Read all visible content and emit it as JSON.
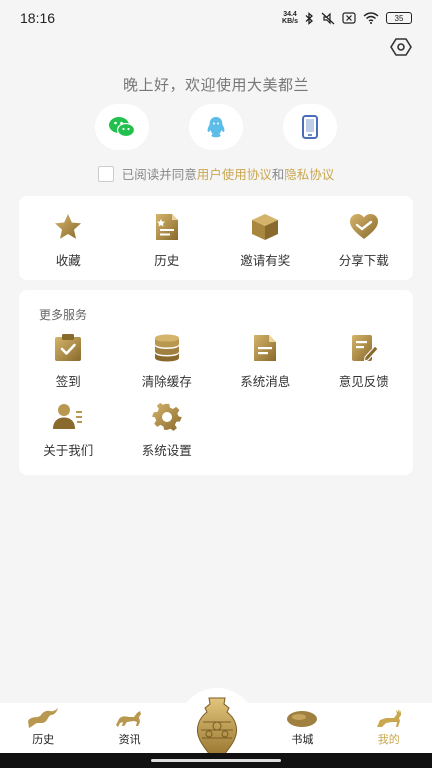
{
  "status": {
    "time": "18:16",
    "net_speed_value": "34.4",
    "net_speed_unit": "KB/s",
    "battery": "35"
  },
  "greeting": "晚上好，欢迎使用大美都兰",
  "login": [
    {
      "name": "wechat-login-button",
      "icon": "wechat-icon"
    },
    {
      "name": "qq-login-button",
      "icon": "qq-icon"
    },
    {
      "name": "phone-login-button",
      "icon": "phone-icon"
    }
  ],
  "agreement": {
    "prefix": "已阅读并同意",
    "user_agreement": "用户使用协议",
    "and": "和",
    "privacy": "隐私协议"
  },
  "quick_actions": [
    {
      "label": "收藏",
      "icon": "star-icon"
    },
    {
      "label": "历史",
      "icon": "document-icon"
    },
    {
      "label": "邀请有奖",
      "icon": "box-icon"
    },
    {
      "label": "分享下载",
      "icon": "heart-share-icon"
    }
  ],
  "more_services": {
    "title": "更多服务",
    "items": [
      {
        "label": "签到",
        "icon": "checkin-icon"
      },
      {
        "label": "清除缓存",
        "icon": "database-icon"
      },
      {
        "label": "系统消息",
        "icon": "message-doc-icon"
      },
      {
        "label": "意见反馈",
        "icon": "feedback-icon"
      },
      {
        "label": "关于我们",
        "icon": "about-user-icon"
      },
      {
        "label": "系统设置",
        "icon": "gear-icon"
      }
    ]
  },
  "tabs": [
    {
      "label": "历史",
      "icon": "dragon-icon",
      "active": false
    },
    {
      "label": "资讯",
      "icon": "horse-icon",
      "active": false
    },
    {
      "label": "书城",
      "icon": "stone-icon",
      "active": false
    },
    {
      "label": "我的",
      "icon": "deer-icon",
      "active": true
    }
  ],
  "colors": {
    "accent": "#c9a74e",
    "icon_gold_dark": "#8a6a2c",
    "icon_gold_light": "#d4b46a",
    "wechat": "#22c14e",
    "qq": "#5bbde8",
    "phone": "#4a6fb8"
  }
}
